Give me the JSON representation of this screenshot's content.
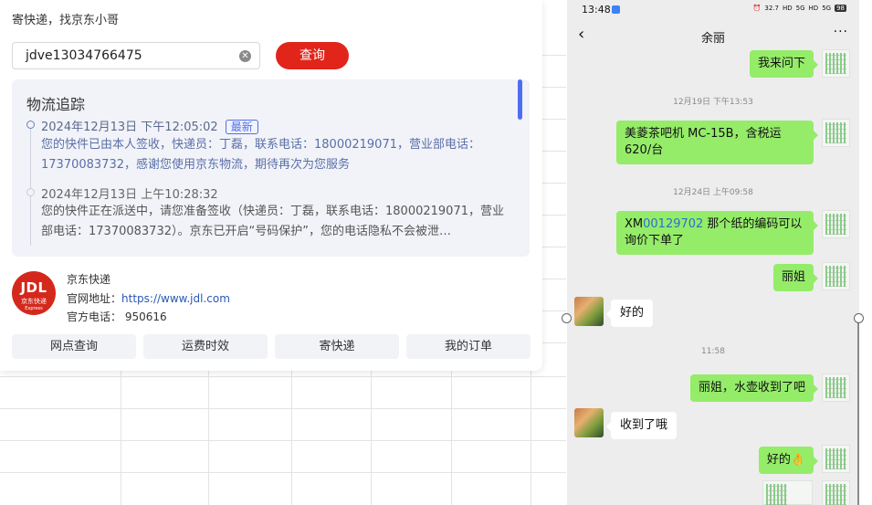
{
  "card": {
    "title": "寄快递，找京东小哥",
    "search_value": "jdve13034766475",
    "query_label": "查询",
    "tracking_heading": "物流追踪",
    "events": [
      {
        "time": "2024年12月13日 下午12:05:02",
        "badge": "最新",
        "text": "您的快件已由本人签收，快递员：丁磊，联系电话：18000219071，营业部电话：17370083732，感谢您使用京东物流，期待再次为您服务"
      },
      {
        "time": "2024年12月13日 上午10:28:32",
        "text": "您的快件正在派送中，请您准备签收（快递员：丁磊，联系电话：18000219071，营业部电话：17370083732）。京东已开启“号码保护”，您的电话隐私不会被泄…"
      }
    ],
    "company": {
      "logo_text": "JDL",
      "logo_sub": "京东快递",
      "logo_sub2": "Express",
      "name": "京东快递",
      "site_label": "官网地址：",
      "site_url": "https://www.jdl.com",
      "phone_label": "官方电话：",
      "phone": "950616"
    },
    "tabs": [
      "网点查询",
      "运费时效",
      "寄快递",
      "我的订单"
    ]
  },
  "phone": {
    "status_time": "13:48",
    "status_right": [
      "32.7",
      "HD",
      "5G",
      "HD",
      "5G",
      "98"
    ],
    "contact": "余丽",
    "messages": [
      {
        "side": "right",
        "text": "我来问下"
      },
      {
        "ts": "12月19日 下午13:53"
      },
      {
        "side": "right",
        "text": "美菱茶吧机 MC-15B，含税运 620/台"
      },
      {
        "ts": "12月24日 上午09:58"
      },
      {
        "side": "right",
        "prefix": "XM",
        "link": "00129702",
        "text": " 那个纸的编码可以询价下单了"
      },
      {
        "side": "right",
        "text": "丽姐"
      },
      {
        "side": "left",
        "text": "好的"
      },
      {
        "ts": "11:58"
      },
      {
        "side": "right",
        "text": "丽姐，水壶收到了吧"
      },
      {
        "side": "left",
        "text": "收到了哦"
      },
      {
        "side": "right",
        "text": "好的👌"
      }
    ]
  }
}
